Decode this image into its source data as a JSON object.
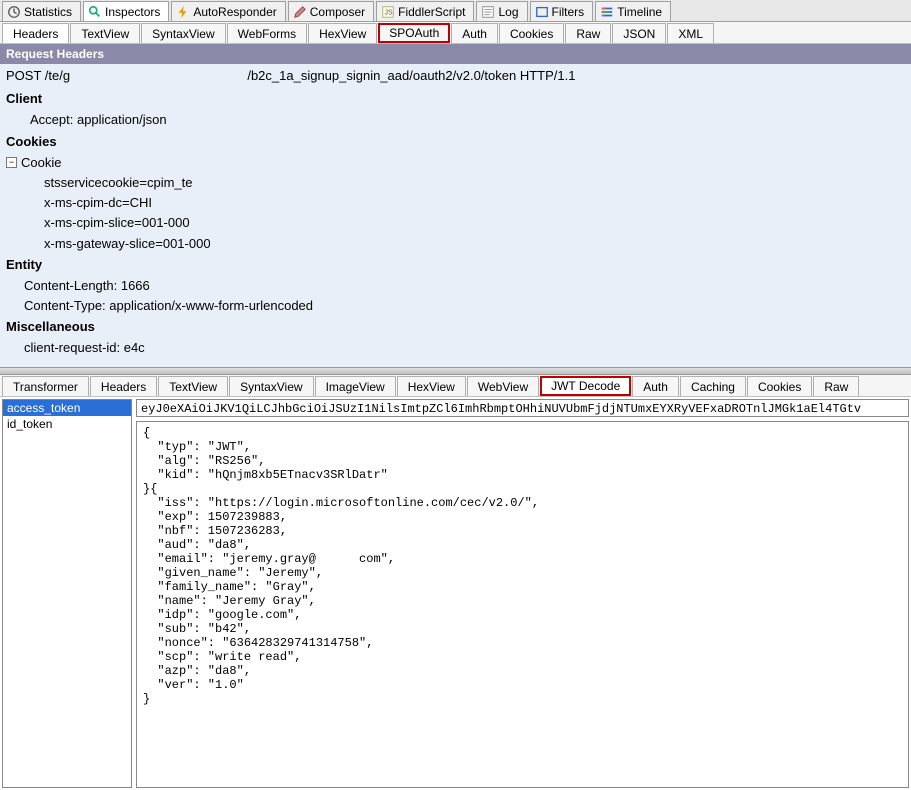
{
  "mainTabs": [
    {
      "label": "Statistics",
      "icon": "clock-icon",
      "active": false
    },
    {
      "label": "Inspectors",
      "icon": "magnifier-icon",
      "active": true
    },
    {
      "label": "AutoResponder",
      "icon": "bolt-icon",
      "active": false
    },
    {
      "label": "Composer",
      "icon": "pencil-icon",
      "active": false
    },
    {
      "label": "FiddlerScript",
      "icon": "script-icon",
      "active": false
    },
    {
      "label": "Log",
      "icon": "log-icon",
      "active": false
    },
    {
      "label": "Filters",
      "icon": "filter-icon",
      "active": false
    },
    {
      "label": "Timeline",
      "icon": "timeline-icon",
      "active": false
    }
  ],
  "requestTabs": [
    {
      "label": "Headers",
      "active": true
    },
    {
      "label": "TextView"
    },
    {
      "label": "SyntaxView"
    },
    {
      "label": "WebForms"
    },
    {
      "label": "HexView"
    },
    {
      "label": "SPOAuth",
      "highlighted": true
    },
    {
      "label": "Auth"
    },
    {
      "label": "Cookies"
    },
    {
      "label": "Raw"
    },
    {
      "label": "JSON"
    },
    {
      "label": "XML"
    }
  ],
  "headersTitle": "Request Headers",
  "requestLine": {
    "prefix": "POST /te/g",
    "middleSpace": "                                ",
    "suffix": "/b2c_1a_signup_signin_aad/oauth2/v2.0/token HTTP/1.1"
  },
  "sections": {
    "client": {
      "title": "Client",
      "items": [
        "Accept: application/json"
      ]
    },
    "cookies": {
      "title": "Cookies",
      "cookieLabel": "Cookie",
      "items": [
        "stsservicecookie=cpim_te",
        "x-ms-cpim-dc=CHI",
        "x-ms-cpim-slice=001-000",
        "x-ms-gateway-slice=001-000"
      ]
    },
    "entity": {
      "title": "Entity",
      "items": [
        "Content-Length: 1666",
        "Content-Type: application/x-www-form-urlencoded"
      ]
    },
    "misc": {
      "title": "Miscellaneous",
      "items": [
        "client-request-id: e4c"
      ]
    }
  },
  "responseTabs": [
    {
      "label": "Transformer"
    },
    {
      "label": "Headers"
    },
    {
      "label": "TextView"
    },
    {
      "label": "SyntaxView"
    },
    {
      "label": "ImageView"
    },
    {
      "label": "HexView"
    },
    {
      "label": "WebView"
    },
    {
      "label": "JWT Decode",
      "active": true,
      "highlighted": true
    },
    {
      "label": "Auth"
    },
    {
      "label": "Caching"
    },
    {
      "label": "Cookies"
    },
    {
      "label": "Raw"
    }
  ],
  "tokens": [
    {
      "label": "access_token",
      "selected": true
    },
    {
      "label": "id_token"
    }
  ],
  "rawToken": "eyJ0eXAiOiJKV1QiLCJhbGciOiJSUzI1NilsImtpZCl6ImhRbmptOHhiNUVUbmFjdjNTUmxEYXRyVEFxaDROTnlJMGk1aEl4TGtv",
  "decoded": "{\n  \"typ\": \"JWT\",\n  \"alg\": \"RS256\",\n  \"kid\": \"hQnjm8xb5ETnacv3SRlDatr\"\n}{\n  \"iss\": \"https://login.microsoftonline.com/cec/v2.0/\",\n  \"exp\": 1507239883,\n  \"nbf\": 1507236283,\n  \"aud\": \"da8\",\n  \"email\": \"jeremy.gray@      com\",\n  \"given_name\": \"Jeremy\",\n  \"family_name\": \"Gray\",\n  \"name\": \"Jeremy Gray\",\n  \"idp\": \"google.com\",\n  \"sub\": \"b42\",\n  \"nonce\": \"636428329741314758\",\n  \"scp\": \"write read\",\n  \"azp\": \"da8\",\n  \"ver\": \"1.0\"\n}"
}
